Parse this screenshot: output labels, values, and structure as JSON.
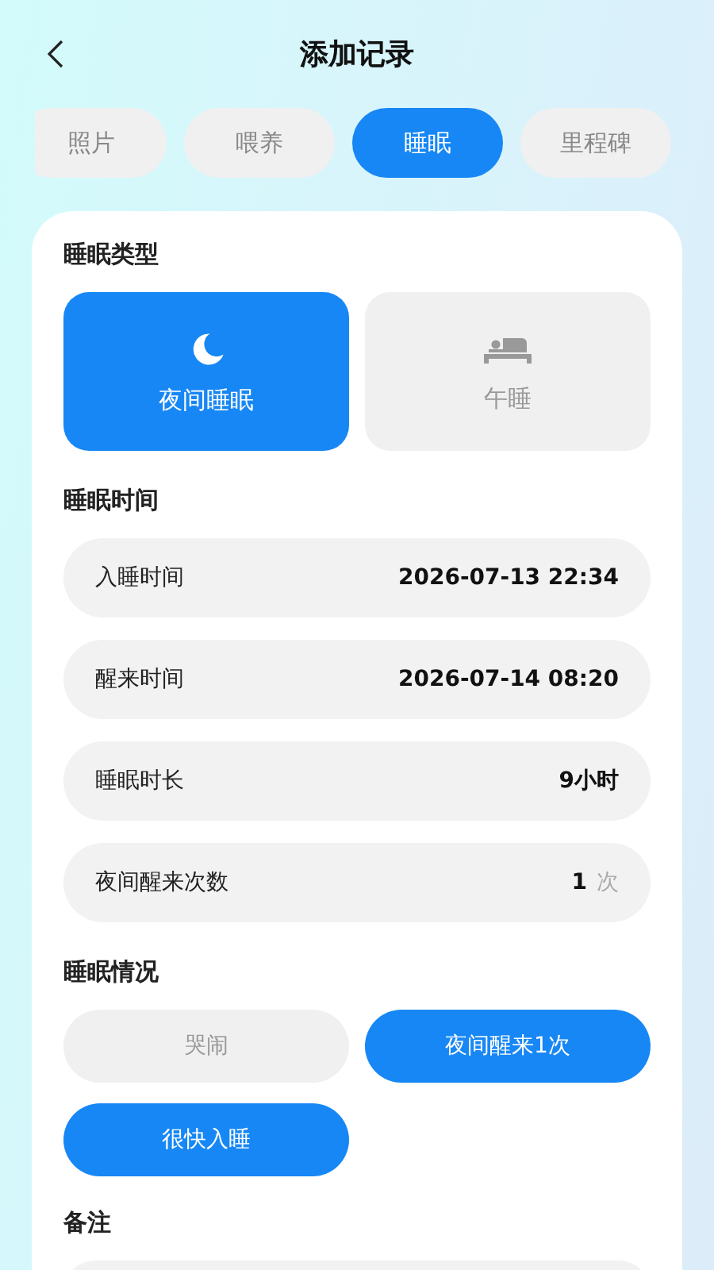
{
  "header": {
    "title": "添加记录"
  },
  "tabs": [
    {
      "label": "照片",
      "selected": false
    },
    {
      "label": "喂养",
      "selected": false
    },
    {
      "label": "睡眠",
      "selected": true
    },
    {
      "label": "里程碑",
      "selected": false
    }
  ],
  "sleep_type": {
    "title": "睡眠类型",
    "options": [
      {
        "label": "夜间睡眠",
        "kind": "moon",
        "selected": true
      },
      {
        "label": "午睡",
        "kind": "bed",
        "selected": false
      }
    ]
  },
  "sleep_time": {
    "title": "睡眠时间",
    "rows": [
      {
        "label": "入睡时间",
        "value": "2026-07-13 22:34"
      },
      {
        "label": "醒来时间",
        "value": "2026-07-14 08:20"
      },
      {
        "label": "睡眠时长",
        "value": "9小时"
      },
      {
        "label": "夜间醒来次数",
        "value": "1",
        "unit": "次"
      }
    ]
  },
  "sleep_condition": {
    "title": "睡眠情况",
    "chips": [
      {
        "label": "哭闹",
        "selected": false
      },
      {
        "label": "夜间醒来1次",
        "selected": true
      },
      {
        "label": "很快入睡",
        "selected": true
      }
    ]
  },
  "remarks": {
    "title": "备注"
  }
}
